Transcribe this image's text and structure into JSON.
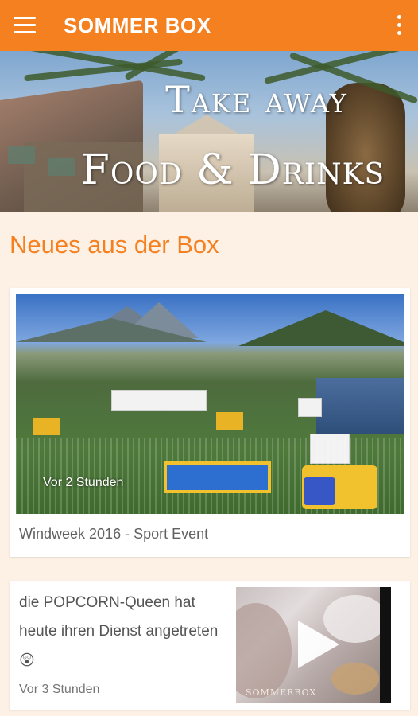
{
  "app_bar": {
    "title": "SOMMER BOX",
    "menu_icon": "hamburger-menu-icon",
    "overflow_icon": "more-vert-icon",
    "color": "#f5801f"
  },
  "banner": {
    "line1": "Take away",
    "line2": "Food & Drinks"
  },
  "section": {
    "title": "Neues aus der Box",
    "title_color": "#f5801f"
  },
  "posts": [
    {
      "timestamp": "Vor 2 Stunden",
      "caption": "Windweek 2016 - Sport Event"
    },
    {
      "text": "die POPCORN-Queen hat heute ihren Dienst angetreten",
      "emoji": "😲",
      "timestamp": "Vor 3 Stunden",
      "thumbnail_brand": "SOMMERBOX",
      "play_icon": "play-icon"
    }
  ]
}
